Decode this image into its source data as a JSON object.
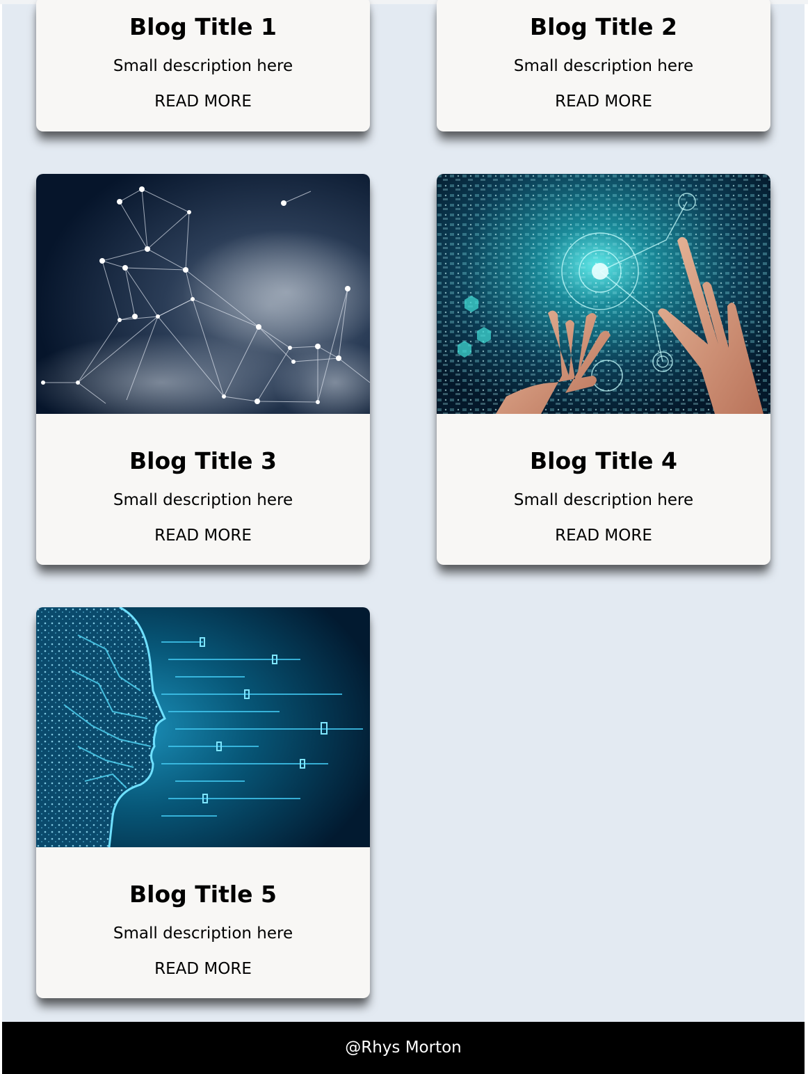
{
  "posts": [
    {
      "title": "Blog Title 1",
      "description": "Small description here",
      "link": "READ MORE"
    },
    {
      "title": "Blog Title 2",
      "description": "Small description here",
      "link": "READ MORE"
    },
    {
      "title": "Blog Title 3",
      "description": "Small description here",
      "link": "READ MORE",
      "image": "network-nodes-image"
    },
    {
      "title": "Blog Title 4",
      "description": "Small description here",
      "link": "READ MORE",
      "image": "digital-hands-circuit-image"
    },
    {
      "title": "Blog Title 5",
      "description": "Small description here",
      "link": "READ MORE",
      "image": "ai-circuit-head-image"
    }
  ],
  "footer": {
    "text": "@Rhys Morton"
  },
  "colors": {
    "background": "#e3eaf2",
    "card": "#f8f7f5",
    "footer": "#000000",
    "footer_text": "#ffffff"
  }
}
